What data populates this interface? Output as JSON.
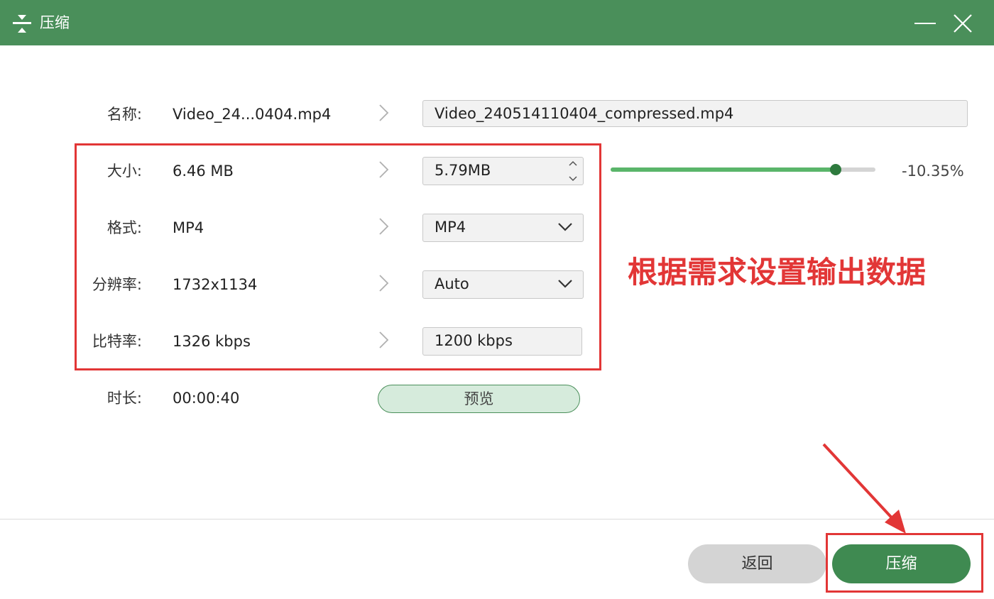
{
  "window": {
    "title": "压缩"
  },
  "rows": {
    "name": {
      "label": "名称:",
      "source": "Video_24...0404.mp4",
      "target": "Video_240514110404_compressed.mp4"
    },
    "size": {
      "label": "大小:",
      "source": "6.46 MB",
      "target": "5.79MB"
    },
    "format": {
      "label": "格式:",
      "source": "MP4",
      "target": "MP4"
    },
    "resolution": {
      "label": "分辨率:",
      "source": "1732x1134",
      "target": "Auto"
    },
    "bitrate": {
      "label": "比特率:",
      "source": "1326 kbps",
      "target": "1200 kbps"
    },
    "duration": {
      "label": "时长:",
      "source": "00:00:40"
    }
  },
  "slider": {
    "percent_text": "-10.35%",
    "level": 0.85
  },
  "annotation": {
    "text": "根据需求设置输出数据"
  },
  "buttons": {
    "preview": "预览",
    "back": "返回",
    "compress": "压缩"
  },
  "colors": {
    "titlebar": "#4a8f5a",
    "accent": "#3f8a51",
    "slider_fill": "#5ab56a",
    "annotation": "#e23636"
  },
  "icons": {
    "app": "compress-icon",
    "minimize": "minimize-icon",
    "close": "close-icon"
  }
}
